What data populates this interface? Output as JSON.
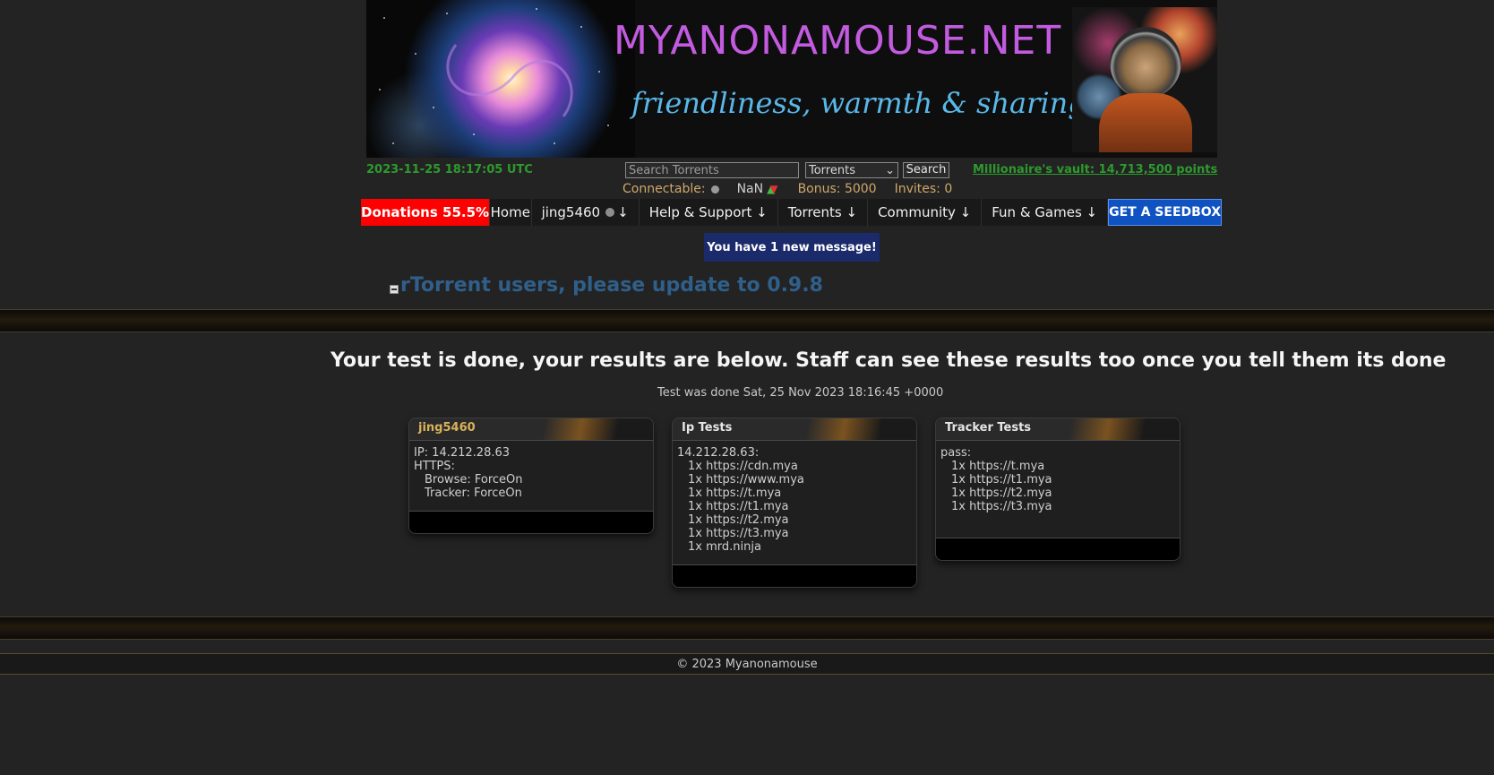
{
  "banner": {
    "site_name": "MYANONAMOUSE.NET",
    "tagline": "friendliness, warmth & sharing"
  },
  "header": {
    "datetime": "2023-11-25 18:17:05 UTC",
    "search_placeholder": "Search Torrents",
    "category_selected": "Torrents",
    "search_button": "Search",
    "vault_link": "Millionaire's vault: 14,713,500 points"
  },
  "status": {
    "connectable_label": "Connectable:",
    "ratio_value": "NaN",
    "bonus": "Bonus: 5000",
    "invites": "Invites: 0"
  },
  "nav": {
    "donations": "Donations 55.5%",
    "home": "Home",
    "user": "jing5460",
    "help": "Help & Support ↓",
    "torrents": "Torrents ↓",
    "community": "Community ↓",
    "fun": "Fun & Games ↓",
    "seedbox": "GET A SEEDBOX",
    "user_arrow": "↓"
  },
  "notice": {
    "message": "You have 1 new message!",
    "news_heading": "rTorrent users, please update to 0.9.8"
  },
  "results": {
    "title": "Your test is done, your results are below. Staff can see these results too once you tell them its done",
    "test_date": "Test was done Sat, 25 Nov 2023 18:16:45 +0000"
  },
  "panels": {
    "user": {
      "title": "jing5460",
      "ip": "IP: 14.212.28.63",
      "https": "HTTPS:",
      "browse": "Browse: ForceOn",
      "tracker": "Tracker: ForceOn"
    },
    "ip_tests": {
      "title": "Ip Tests",
      "address": "14.212.28.63:",
      "lines": [
        "1x https://cdn.mya",
        "1x https://www.mya",
        "1x https://t.mya",
        "1x https://t1.mya",
        "1x https://t2.mya",
        "1x https://t3.mya",
        "1x mrd.ninja"
      ]
    },
    "tracker_tests": {
      "title": "Tracker Tests",
      "status": "pass:",
      "lines": [
        "1x https://t.mya",
        "1x https://t1.mya",
        "1x https://t2.mya",
        "1x https://t3.mya"
      ]
    }
  },
  "footer": {
    "copyright": "© 2023 Myanonamouse"
  },
  "colors": {
    "green_text": "#2e9a2e",
    "donations_bg": "#ff0000",
    "seedbox_bg": "#0f52c2",
    "message_bg": "#1b2a6a",
    "news_heading": "#2f5f8a"
  }
}
